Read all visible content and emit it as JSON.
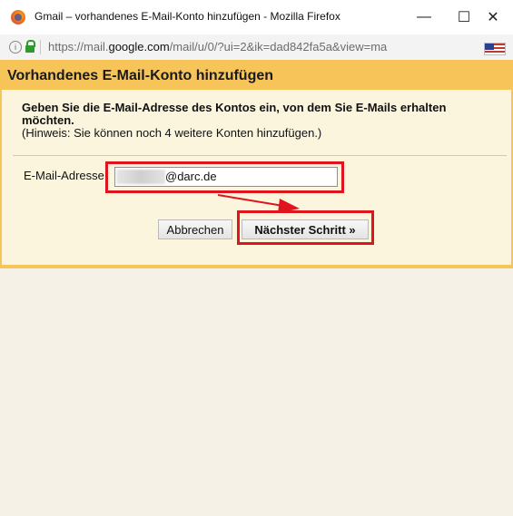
{
  "window": {
    "title": "Gmail – vorhandenes E-Mail-Konto hinzufügen - Mozilla Firefox",
    "minimize_glyph": "—",
    "maximize_glyph": "☐",
    "close_glyph": "✕"
  },
  "urlbar": {
    "url_prefix": "https://mail.",
    "url_domain": "google.com",
    "url_rest": "/mail/u/0/?ui=2&ik=dad842fa5a&view=ma",
    "info_glyph": "i"
  },
  "dialog": {
    "title": "Vorhandenes E-Mail-Konto hinzufügen",
    "instruction": "Geben Sie die E-Mail-Adresse des Kontos ein, von dem Sie E-Mails erhalten möchten.",
    "hint": "(Hinweis: Sie können noch 4 weitere Konten hinzufügen.)",
    "email_label": "E-Mail-Adresse:",
    "email_value_visible": "@darc.de",
    "cancel_label": "Abbrechen",
    "next_label": "Nächster Schritt »"
  },
  "colors": {
    "header_bg": "#f7c45a",
    "dialog_bg": "#fcf5dd",
    "annotation_red": "#e0141c"
  }
}
